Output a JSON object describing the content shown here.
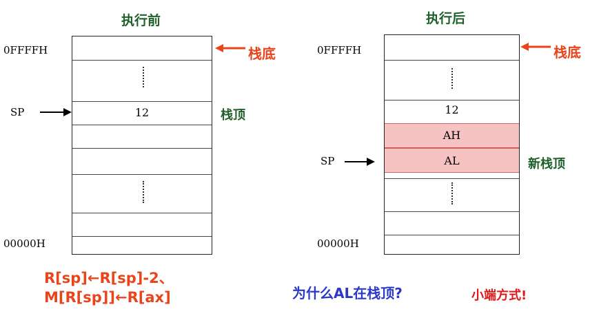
{
  "left": {
    "title": "执行前",
    "top_addr": "0FFFFH",
    "bottom_addr": "00000H",
    "sp_label": "SP",
    "sp_value": "12",
    "bottom_label": "栈底",
    "top_label": "栈顶"
  },
  "right": {
    "title": "执行后",
    "top_addr": "0FFFFH",
    "bottom_addr": "00000H",
    "sp_label": "SP",
    "cell_12": "12",
    "cell_ah": "AH",
    "cell_al": "AL",
    "bottom_label": "栈底",
    "new_top_label": "新栈顶"
  },
  "formula": {
    "line1": "R[sp]←R[sp]-2、",
    "line2": "M[R[sp]]←R[ax]"
  },
  "question": "为什么AL在栈顶?",
  "answer": "小端方式!",
  "colors": {
    "title_green": "#1f5f2a",
    "red": "#e8451c",
    "blue": "#2b39c8",
    "highlight": "#f7c2c2"
  }
}
